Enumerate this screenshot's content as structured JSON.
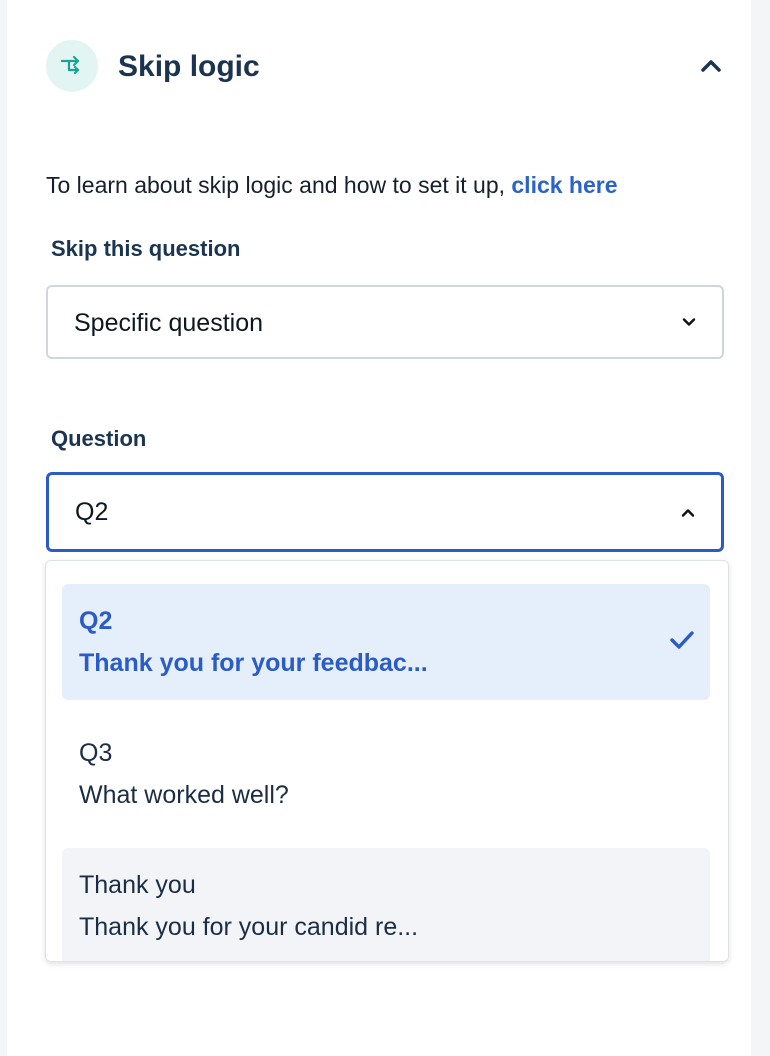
{
  "section": {
    "title": "Skip logic",
    "icon": "branch-icon",
    "expanded": true
  },
  "intro": {
    "text": "To learn about skip logic and how to set it up, ",
    "link_text": "click here"
  },
  "skip_field": {
    "label": "Skip this question",
    "value": "Specific question"
  },
  "question_field": {
    "label": "Question",
    "value": "Q2",
    "open": true
  },
  "options": [
    {
      "line1": "Q2",
      "line2": "Thank you for your feedbac...",
      "state": "selected"
    },
    {
      "line1": "Q3",
      "line2": "What worked well?",
      "state": "normal"
    },
    {
      "line1": "Thank you",
      "line2": "Thank you for your candid re...",
      "state": "hovered"
    }
  ],
  "colors": {
    "accent": "#2b5cc5",
    "selected_bg": "#e4effb",
    "icon_bg": "#e3f5f3",
    "icon_fg": "#1aa394",
    "heading": "#1b3550"
  }
}
